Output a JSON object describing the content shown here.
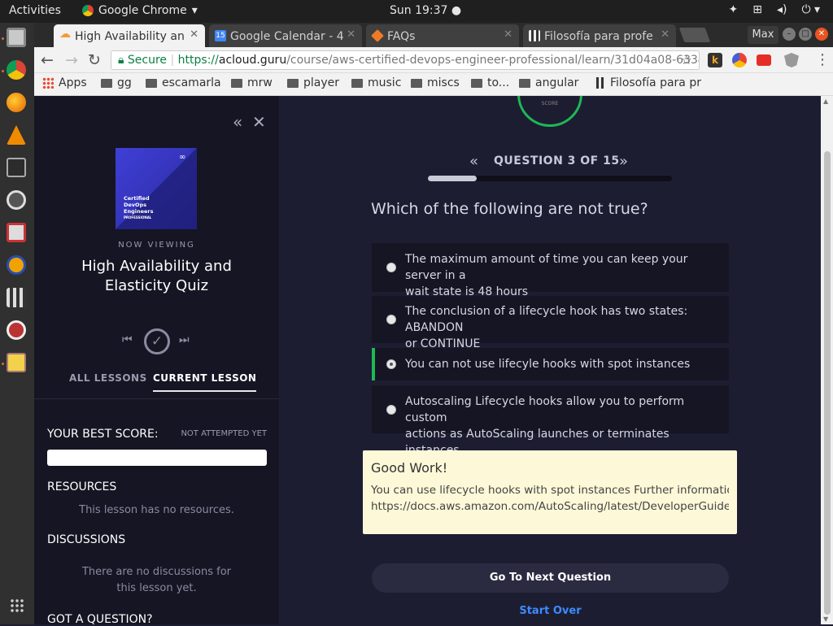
{
  "topbar": {
    "activities": "Activities",
    "app": "Google Chrome",
    "clock": "Sun 19:37 ●",
    "power_icon": "power-icon",
    "volume_icon": "volume-icon",
    "network_icon": "network-icon"
  },
  "tabs": [
    {
      "label": "High Availability an",
      "icon": "acloud-icon"
    },
    {
      "label": "Google Calendar - 4",
      "icon": "calendar-icon",
      "badge": "15"
    },
    {
      "label": "FAQs",
      "icon": "faqs-icon"
    },
    {
      "label": "Filosofía para profe",
      "icon": "film-icon"
    }
  ],
  "window": {
    "max_label": "Max"
  },
  "omnibox": {
    "secure": "Secure",
    "url_prefix": "https://",
    "url_host": "acloud.guru",
    "url_path": "/course/aws-certified-devops-engineer-professional/learn/31d04a08-6334-..."
  },
  "bookmarks": [
    {
      "label": "Apps"
    },
    {
      "label": "gg"
    },
    {
      "label": "escamarla"
    },
    {
      "label": "mrw"
    },
    {
      "label": "player"
    },
    {
      "label": "music"
    },
    {
      "label": "miscs"
    },
    {
      "label": "to..."
    },
    {
      "label": "angular"
    },
    {
      "label": "Filosofía para pr"
    }
  ],
  "sidebar": {
    "course_thumb_text": [
      "Certified",
      "DevOps",
      "Engineers",
      "PROFESSIONAL"
    ],
    "now_viewing": "NOW VIEWING",
    "lesson_title_line1": "High Availability and",
    "lesson_title_line2": "Elasticity Quiz",
    "tab_all": "ALL LESSONS",
    "tab_current": "CURRENT LESSON",
    "best_score_label": "YOUR BEST SCORE:",
    "best_score_value": "NOT ATTEMPTED YET",
    "resources_heading": "RESOURCES",
    "resources_empty": "This lesson has no resources.",
    "discussions_heading": "DISCUSSIONS",
    "discussions_empty_1": "There are no discussions for",
    "discussions_empty_2": "this lesson yet.",
    "question_heading": "GOT A QUESTION?"
  },
  "quiz": {
    "score_label": "SCORE",
    "question_counter": "QUESTION 3 OF 15",
    "progress": 0.2,
    "question": "Which of the following are not true?",
    "options": [
      {
        "line1": "The maximum amount of time you can keep your server in a",
        "line2": "wait state is 48 hours"
      },
      {
        "line1": "The conclusion of a lifecycle hook has two states: ABANDON",
        "line2": "or CONTINUE"
      },
      {
        "line1": "You can not use lifecyle hooks with spot instances",
        "line2": ""
      },
      {
        "line1": "Autoscaling Lifecycle hooks allow you to perform custom",
        "line2": "actions as AutoScaling launches or terminates instances"
      }
    ],
    "feedback_title": "Good Work!",
    "feedback_line1": "You can use lifecycle hooks with spot instances Further information:",
    "feedback_line2": "https://docs.aws.amazon.com/AutoScaling/latest/DeveloperGuide/...",
    "next_button": "Go To Next Question",
    "start_over": "Start Over"
  },
  "colors": {
    "accent_green": "#1db954",
    "link_blue": "#3d8bfd",
    "feedback_bg": "#fcf8d8"
  }
}
